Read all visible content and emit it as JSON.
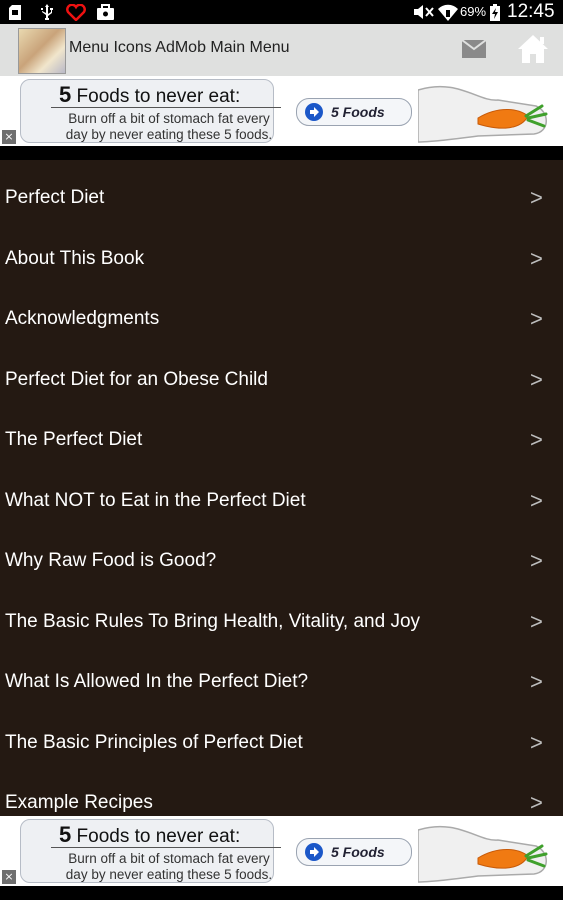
{
  "status_bar": {
    "battery_percent": "69%",
    "time": "12:45"
  },
  "action_bar": {
    "title": "Menu Icons AdMob Main Menu"
  },
  "ad": {
    "headline_number": "5",
    "headline_text": " Foods to never eat:",
    "body_line1": "Burn off a bit of stomach fat every",
    "body_line2": "day by never eating these 5 foods.",
    "cta_label": "5 Foods",
    "close_glyph": "×"
  },
  "menu": {
    "items": [
      "Perfect Diet",
      "About This Book",
      "Acknowledgments",
      "Perfect Diet for an Obese Child",
      "The Perfect Diet",
      "What NOT to Eat in the Perfect Diet",
      "Why Raw Food is Good?",
      "The Basic Rules To Bring Health, Vitality, and Joy",
      "What Is Allowed In the Perfect Diet?",
      "The Basic Principles of Perfect Diet",
      "Example Recipes"
    ],
    "chevron": ">"
  },
  "icons": [
    "sd-card-icon",
    "usb-icon",
    "heart-icon",
    "bag-icon",
    "mute-icon",
    "wifi-icon",
    "battery-icon",
    "mail-icon",
    "home-icon",
    "carrot-icon",
    "arrow-right-icon",
    "close-icon",
    "chevron-right-icon"
  ]
}
